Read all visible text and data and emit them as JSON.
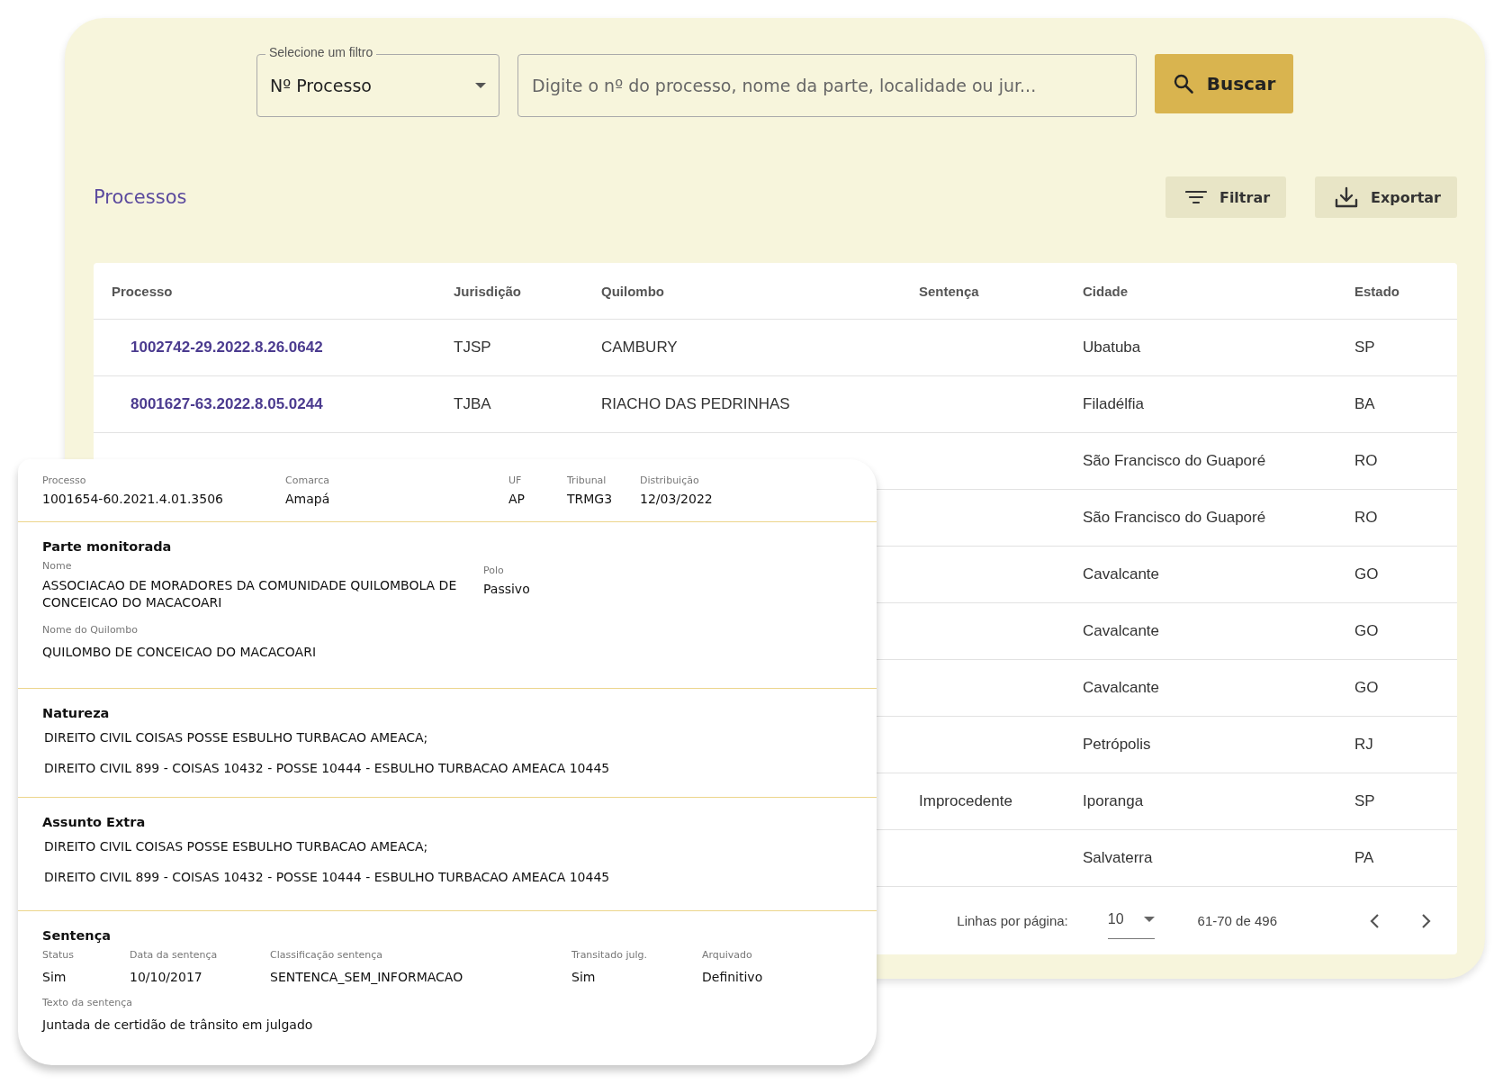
{
  "filter": {
    "label": "Selecione um filtro",
    "value": "Nº Processo"
  },
  "search": {
    "placeholder": "Digite o nº do processo, nome da parte, localidade ou jur..."
  },
  "search_button": "Buscar",
  "section_title": "Processos",
  "toolbar": [
    {
      "kind": "filter",
      "label": "Filtrar"
    },
    {
      "kind": "export",
      "label": "Exportar"
    }
  ],
  "table": {
    "columns": [
      "Processo",
      "Jurisdição",
      "Quilombo",
      "Sentença",
      "Cidade",
      "Estado"
    ],
    "rows": [
      {
        "processo": "1002742-29.2022.8.26.0642",
        "jurisdicao": "TJSP",
        "quilombo": "CAMBURY",
        "cidade": "Ubatuba",
        "estado": "SP"
      },
      {
        "processo": "8001627-63.2022.8.05.0244",
        "jurisdicao": "TJBA",
        "quilombo": "RIACHO DAS PEDRINHAS",
        "cidade": "Filadélfia",
        "estado": "BA"
      },
      {
        "cidade": "São Francisco do Guaporé",
        "estado": "RO"
      },
      {
        "cidade": "São Francisco do Guaporé",
        "estado": "RO"
      },
      {
        "cidade": "Cavalcante",
        "estado": "GO"
      },
      {
        "cidade": "Cavalcante",
        "estado": "GO"
      },
      {
        "cidade": "Cavalcante",
        "estado": "GO"
      },
      {
        "cidade": "Petrópolis",
        "estado": "RJ"
      },
      {
        "sentenca": "Improcedente",
        "cidade": "Iporanga",
        "estado": "SP"
      },
      {
        "cidade": "Salvaterra",
        "estado": "PA"
      }
    ]
  },
  "pagination": {
    "rows_label": "Linhas por página:",
    "rows_value": "10",
    "range": "61-70 de 496"
  },
  "detail_card": {
    "header": [
      {
        "label": "Processo",
        "value": "1001654-60.2021.4.01.3506"
      },
      {
        "label": "Comarca",
        "value": "Amapá"
      },
      {
        "label": "UF",
        "value": "AP"
      },
      {
        "label": "Tribunal",
        "value": "TRMG3"
      },
      {
        "label": "Distribuição",
        "value": "12/03/2022"
      }
    ],
    "parte_monitorada": {
      "title": "Parte monitorada",
      "nome_label": "Nome",
      "nome": "ASSOCIACAO DE MORADORES DA COMUNIDADE QUILOMBOLA DE CONCEICAO DO MACACOARI",
      "polo_label": "Polo",
      "polo": "Passivo",
      "quilombo_label": "Nome do Quilombo",
      "quilombo": "QUILOMBO DE CONCEICAO DO MACACOARI"
    },
    "natureza": {
      "title": "Natureza",
      "lines": [
        "DIREITO CIVIL COISAS POSSE ESBULHO TURBACAO AMEACA;",
        "DIREITO CIVIL 899 - COISAS 10432 - POSSE 10444 - ESBULHO TURBACAO AMEACA 10445"
      ]
    },
    "assunto_extra": {
      "title": "Assunto Extra",
      "lines": [
        "DIREITO CIVIL COISAS POSSE ESBULHO TURBACAO AMEACA;",
        "DIREITO CIVIL 899 - COISAS 10432 - POSSE 10444 - ESBULHO TURBACAO AMEACA 10445"
      ]
    },
    "sentenca": {
      "title": "Sentença",
      "fields": [
        {
          "label": "Status",
          "value": "Sim"
        },
        {
          "label": "Data da sentença",
          "value": "10/10/2017"
        },
        {
          "label": "Classificação sentença",
          "value": "SENTENCA_SEM_INFORMACAO"
        },
        {
          "label": "Transitado julg.",
          "value": "Sim"
        },
        {
          "label": "Arquivado",
          "value": "Definitivo"
        }
      ],
      "texto_label": "Texto da sentença",
      "texto": "Juntada de certidão de trânsito em julgado"
    }
  }
}
